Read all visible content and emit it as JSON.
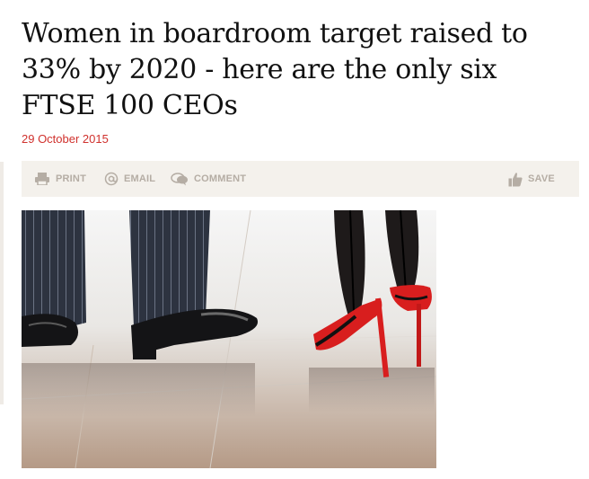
{
  "article": {
    "headline": "Women in boardroom target raised to 33% by 2020 - here are the only six FTSE 100 CEOs",
    "date": "29 October 2015"
  },
  "toolbar": {
    "print": {
      "label": "PRINT",
      "icon": "printer-icon"
    },
    "email": {
      "label": "EMAIL",
      "icon": "at-icon"
    },
    "comment": {
      "label": "COMMENT",
      "icon": "speech-bubble-icon"
    },
    "save": {
      "label": "SAVE",
      "icon": "thumbs-up-icon"
    }
  },
  "image": {
    "content": "Men's pinstripe trouser legs and black shoes beside a woman's legs in dark stockings and red high heels on a tiled floor"
  },
  "colors": {
    "date": "#d0312d",
    "toolbar_bg": "#f4f1ec",
    "toolbar_text": "#b5ada4",
    "heel_red": "#d81e1e"
  }
}
